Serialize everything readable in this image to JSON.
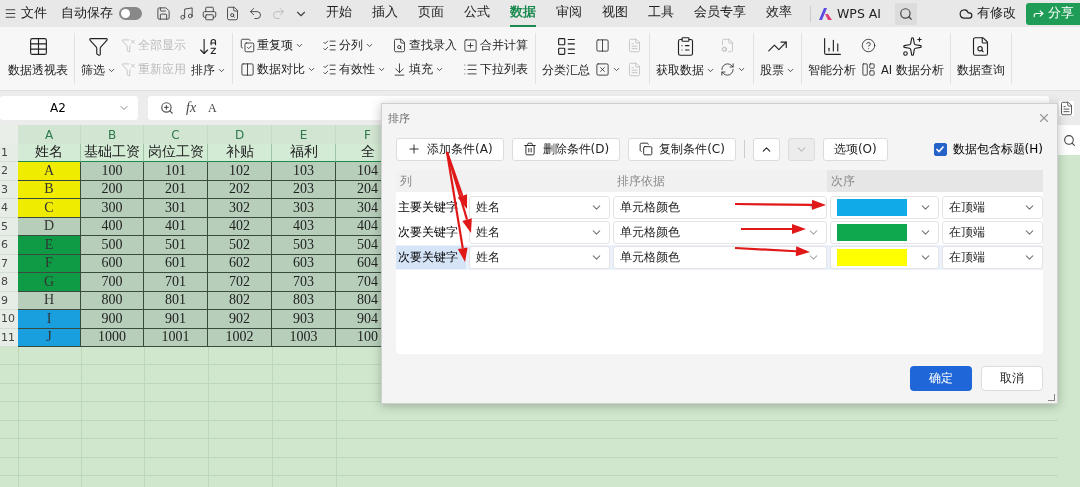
{
  "menu_bar": {
    "file": "文件",
    "autosave": {
      "label": "自动保存",
      "on": false
    },
    "tabs": [
      {
        "label": "开始",
        "selected": false
      },
      {
        "label": "插入",
        "selected": false
      },
      {
        "label": "页面",
        "selected": false
      },
      {
        "label": "公式",
        "selected": false
      },
      {
        "label": "数据",
        "selected": true
      },
      {
        "label": "审阅",
        "selected": false
      },
      {
        "label": "视图",
        "selected": false
      },
      {
        "label": "工具",
        "selected": false
      },
      {
        "label": "会员专享",
        "selected": false
      },
      {
        "label": "效率",
        "selected": false
      }
    ],
    "ai": "WPS AI",
    "status": "有修改",
    "share": "分享"
  },
  "ribbon": {
    "groups": [
      {
        "items": [
          {
            "kind": "large",
            "label": "数据透视表",
            "dropdown": false,
            "disabled": false
          }
        ]
      },
      {
        "items": [
          {
            "kind": "large",
            "label": "筛选",
            "dropdown": true,
            "disabled": false
          },
          {
            "kind": "small",
            "label": "全部显示",
            "dropdown": false,
            "disabled": true
          },
          {
            "kind": "small",
            "label": "重新应用",
            "dropdown": false,
            "disabled": true
          },
          {
            "kind": "large",
            "label": "排序",
            "dropdown": true,
            "disabled": false
          }
        ]
      },
      {
        "items": [
          {
            "kind": "small",
            "label": "重复项",
            "dropdown": true,
            "disabled": false
          },
          {
            "kind": "small",
            "label": "数据对比",
            "dropdown": true,
            "disabled": false
          },
          {
            "kind": "small",
            "label": "分列",
            "dropdown": true,
            "disabled": false
          },
          {
            "kind": "small",
            "label": "有效性",
            "dropdown": true,
            "disabled": false
          },
          {
            "kind": "small",
            "label": "查找录入",
            "dropdown": false,
            "disabled": false
          },
          {
            "kind": "small",
            "label": "填充",
            "dropdown": true,
            "disabled": false
          },
          {
            "kind": "small",
            "label": "合并计算",
            "dropdown": false,
            "disabled": false
          },
          {
            "kind": "small",
            "label": "下拉列表",
            "dropdown": false,
            "disabled": false
          }
        ]
      },
      {
        "items": [
          {
            "kind": "large",
            "label": "分类汇总",
            "dropdown": false,
            "disabled": false
          },
          {
            "kind": "icon",
            "dropdown": false,
            "disabled": false
          },
          {
            "kind": "icon",
            "dropdown": true,
            "disabled": false
          },
          {
            "kind": "icon",
            "dropdown": false,
            "disabled": true
          },
          {
            "kind": "icon",
            "dropdown": false,
            "disabled": true
          }
        ]
      },
      {
        "items": [
          {
            "kind": "large",
            "label": "获取数据",
            "dropdown": true,
            "disabled": false
          },
          {
            "kind": "icon",
            "dropdown": false,
            "disabled": true
          },
          {
            "kind": "icon",
            "dropdown": true,
            "disabled": false
          }
        ]
      },
      {
        "items": [
          {
            "kind": "large",
            "label": "股票",
            "dropdown": true,
            "disabled": false
          }
        ]
      },
      {
        "items": [
          {
            "kind": "large",
            "label": "智能分析",
            "dropdown": false,
            "disabled": false
          },
          {
            "kind": "icon",
            "dropdown": false,
            "disabled": false
          },
          {
            "kind": "icon",
            "dropdown": false,
            "disabled": false
          },
          {
            "kind": "large",
            "label": "AI 数据分析",
            "dropdown": false,
            "disabled": false
          }
        ]
      },
      {
        "items": [
          {
            "kind": "large",
            "label": "数据查询",
            "dropdown": false,
            "disabled": false
          }
        ]
      }
    ]
  },
  "formula_bar": {
    "name_box": "A2",
    "fx": "fx",
    "value": "A"
  },
  "sheet": {
    "columns": [
      "A",
      "B",
      "C",
      "D",
      "E",
      "F"
    ],
    "header_number": "1",
    "header": [
      "姓名",
      "基础工资",
      "岗位工资",
      "补贴",
      "福利",
      "全"
    ],
    "rows": [
      {
        "number": "2",
        "name": "A",
        "color": "#f0ec00",
        "values": [
          "100",
          "101",
          "102",
          "103",
          "104"
        ]
      },
      {
        "number": "3",
        "name": "B",
        "color": "#f0ec00",
        "values": [
          "200",
          "201",
          "202",
          "203",
          "204"
        ]
      },
      {
        "number": "4",
        "name": "C",
        "color": "#f0ec00",
        "values": [
          "300",
          "301",
          "302",
          "303",
          "304"
        ]
      },
      {
        "number": "5",
        "name": "D",
        "values": [
          "400",
          "401",
          "402",
          "403",
          "404"
        ]
      },
      {
        "number": "6",
        "name": "E",
        "color": "#0f9a45",
        "values": [
          "500",
          "501",
          "502",
          "503",
          "504"
        ]
      },
      {
        "number": "7",
        "name": "F",
        "color": "#0f9a45",
        "values": [
          "600",
          "601",
          "602",
          "603",
          "604"
        ]
      },
      {
        "number": "8",
        "name": "G",
        "color": "#0f9a45",
        "values": [
          "700",
          "701",
          "702",
          "703",
          "704"
        ]
      },
      {
        "number": "9",
        "name": "H",
        "values": [
          "800",
          "801",
          "802",
          "803",
          "804"
        ]
      },
      {
        "number": "10",
        "name": "I",
        "color": "#1a9fde",
        "values": [
          "900",
          "901",
          "902",
          "903",
          "904"
        ]
      },
      {
        "number": "11",
        "name": "J",
        "color": "#1a9fde",
        "values": [
          "1000",
          "1001",
          "1002",
          "1003",
          "100"
        ]
      }
    ]
  },
  "dialog": {
    "title": "排序",
    "toolbar": [
      {
        "kind": "add",
        "label": "添加条件(A)"
      },
      {
        "kind": "delete",
        "label": "删除条件(D)"
      },
      {
        "kind": "copy",
        "label": "复制条件(C)"
      }
    ],
    "move_up": {
      "disabled": false
    },
    "move_down": {
      "disabled": true
    },
    "options": "选项(O)",
    "has_header": {
      "label": "数据包含标题(H)",
      "checked": true
    },
    "columns": [
      "列",
      "排序依据",
      "次序"
    ],
    "rows": [
      {
        "key": "主要关键字",
        "column": "姓名",
        "basis": "单元格颜色",
        "color": "#10aae8",
        "position": "在顶端",
        "selected": false
      },
      {
        "key": "次要关键字",
        "column": "姓名",
        "basis": "单元格颜色",
        "color": "#10a84e",
        "position": "在顶端",
        "selected": false
      },
      {
        "key": "次要关键字",
        "column": "姓名",
        "basis": "单元格颜色",
        "color": "#ffff00",
        "position": "在顶端",
        "selected": true
      }
    ],
    "ok": "确定",
    "cancel": "取消"
  }
}
